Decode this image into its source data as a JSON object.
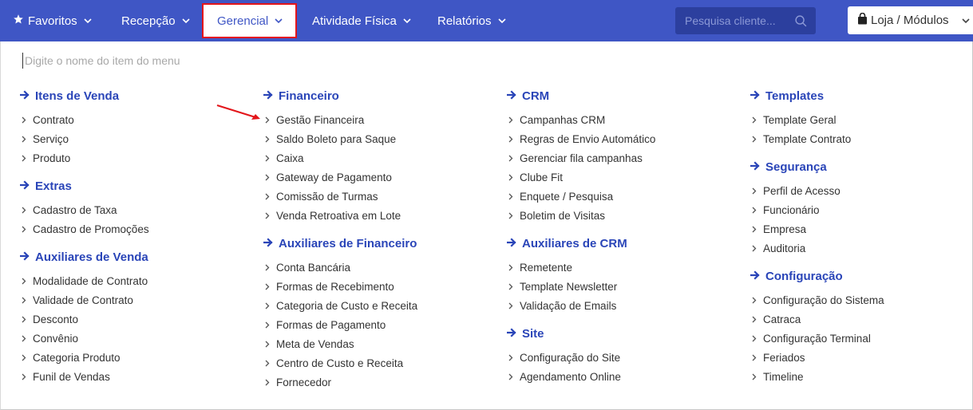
{
  "nav": {
    "items": [
      {
        "label": "Favoritos",
        "name": "nav-favoritos"
      },
      {
        "label": "Recepção",
        "name": "nav-recepcao"
      },
      {
        "label": "Gerencial",
        "name": "nav-gerencial"
      },
      {
        "label": "Atividade Física",
        "name": "nav-atividade-fisica"
      },
      {
        "label": "Relatórios",
        "name": "nav-relatorios"
      }
    ],
    "search_placeholder": "Pesquisa cliente...",
    "loja_label": "Loja / Módulos"
  },
  "panel": {
    "filter_placeholder": "Digite o nome do item do menu",
    "columns": [
      {
        "sections": [
          {
            "title": "Itens de Venda",
            "items": [
              "Contrato",
              "Serviço",
              "Produto"
            ]
          },
          {
            "title": "Extras",
            "items": [
              "Cadastro de Taxa",
              "Cadastro de Promoções"
            ]
          },
          {
            "title": "Auxiliares de Venda",
            "items": [
              "Modalidade de Contrato",
              "Validade de Contrato",
              "Desconto",
              "Convênio",
              "Categoria Produto",
              "Funil de Vendas"
            ]
          }
        ]
      },
      {
        "sections": [
          {
            "title": "Financeiro",
            "items": [
              "Gestão Financeira",
              "Saldo Boleto para Saque",
              "Caixa",
              "Gateway de Pagamento",
              "Comissão de Turmas",
              "Venda Retroativa em Lote"
            ]
          },
          {
            "title": "Auxiliares de Financeiro",
            "items": [
              "Conta Bancária",
              "Formas de Recebimento",
              "Categoria de Custo e Receita",
              "Formas de Pagamento",
              "Meta de Vendas",
              "Centro de Custo e Receita",
              "Fornecedor"
            ]
          }
        ]
      },
      {
        "sections": [
          {
            "title": "CRM",
            "items": [
              "Campanhas CRM",
              "Regras de Envio Automático",
              "Gerenciar fila campanhas",
              "Clube Fit",
              "Enquete / Pesquisa",
              "Boletim de Visitas"
            ]
          },
          {
            "title": "Auxiliares de CRM",
            "items": [
              "Remetente",
              "Template Newsletter",
              "Validação de Emails"
            ]
          },
          {
            "title": "Site",
            "items": [
              "Configuração do Site",
              "Agendamento Online"
            ]
          }
        ]
      },
      {
        "sections": [
          {
            "title": "Templates",
            "items": [
              "Template Geral",
              "Template Contrato"
            ]
          },
          {
            "title": "Segurança",
            "items": [
              "Perfil de Acesso",
              "Funcionário",
              "Empresa",
              "Auditoria"
            ]
          },
          {
            "title": "Configuração",
            "items": [
              "Configuração do Sistema",
              "Catraca",
              "Configuração Terminal",
              "Feriados",
              "Timeline"
            ]
          }
        ]
      }
    ]
  },
  "colors": {
    "nav_bg": "#3f56c5",
    "section_title": "#2a45b8",
    "highlight_border": "#e3151a",
    "annotation_arrow": "#e3151a"
  }
}
